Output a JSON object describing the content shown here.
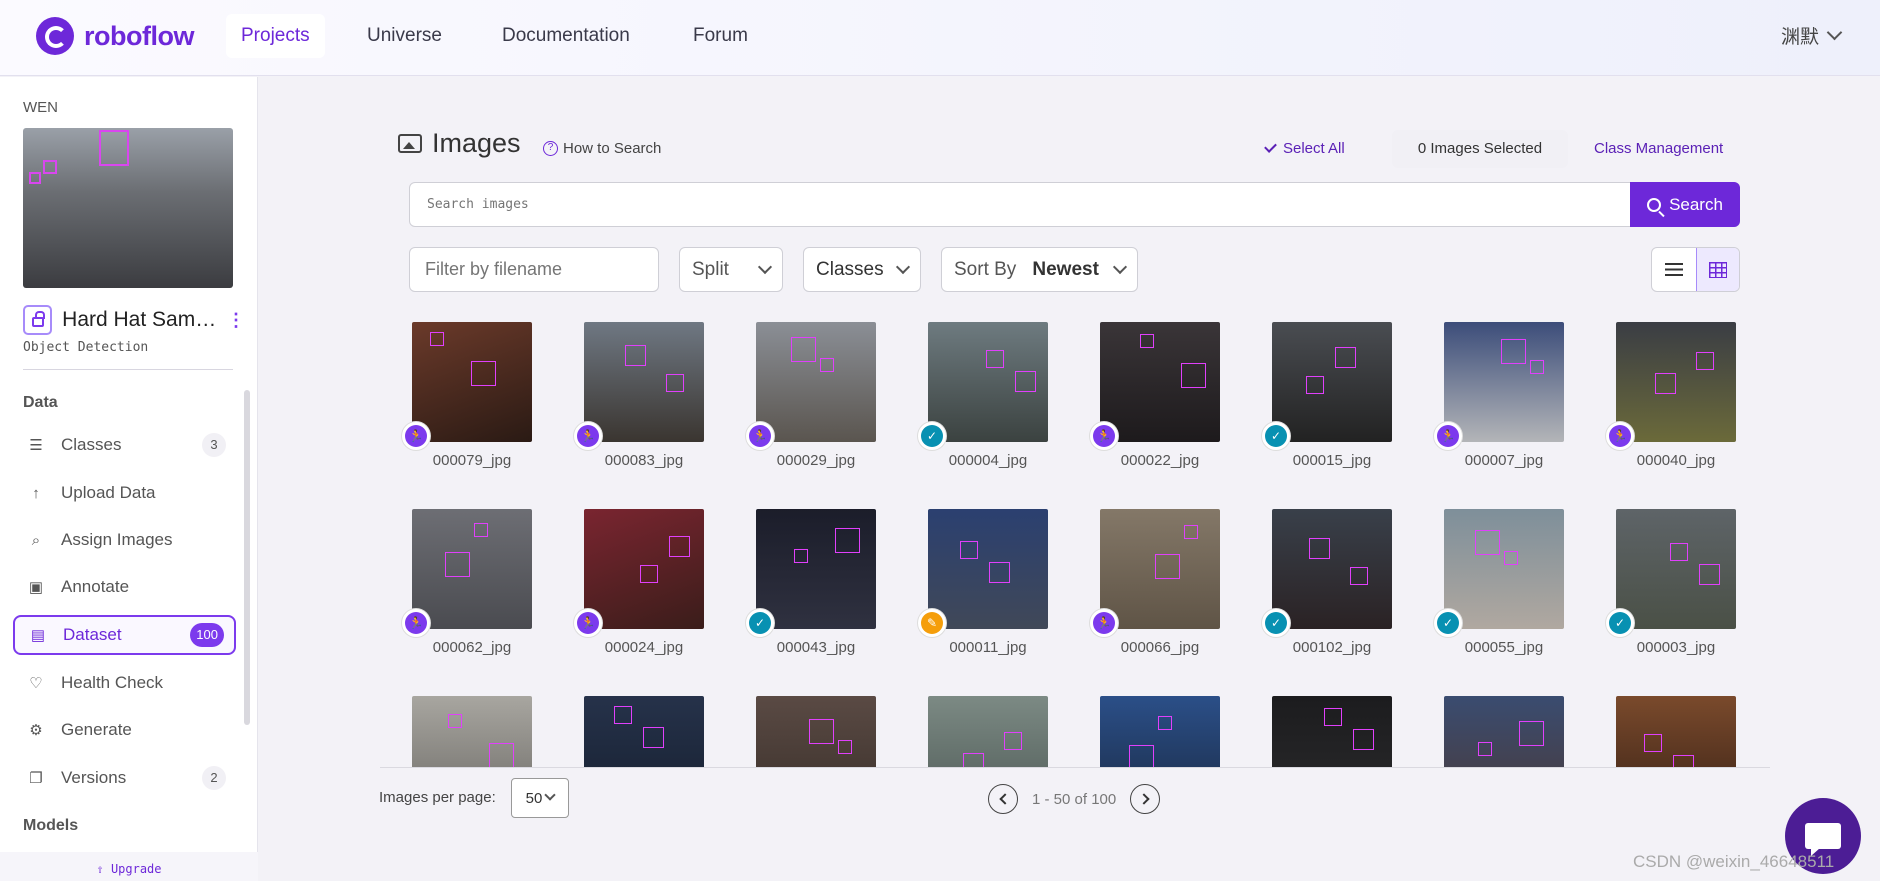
{
  "app": {
    "name": "roboflow",
    "brand_color": "#6d28d9"
  },
  "nav": {
    "tabs": [
      "Projects",
      "Universe",
      "Documentation",
      "Forum"
    ],
    "active": "Projects",
    "user": "渊默"
  },
  "sidebar": {
    "workspace": "WEN",
    "project_name": "Hard Hat Samp...",
    "project_type": "Object Detection",
    "section_data": "Data",
    "items": [
      {
        "label": "Classes",
        "count": "3",
        "icon": "list-icon"
      },
      {
        "label": "Upload Data",
        "count": null,
        "icon": "upload-icon"
      },
      {
        "label": "Assign Images",
        "count": null,
        "icon": "search-icon"
      },
      {
        "label": "Annotate",
        "count": null,
        "icon": "annotate-icon"
      },
      {
        "label": "Dataset",
        "count": "100",
        "icon": "dataset-icon"
      },
      {
        "label": "Health Check",
        "count": null,
        "icon": "heart-icon"
      },
      {
        "label": "Generate",
        "count": null,
        "icon": "generate-icon"
      },
      {
        "label": "Versions",
        "count": "2",
        "icon": "versions-icon"
      }
    ],
    "active_item": "Dataset",
    "section_models": "Models",
    "upgrade": "Upgrade"
  },
  "main": {
    "title": "Images",
    "how_to_search": "How to Search",
    "select_all": "Select All",
    "selected": "0 Images Selected",
    "class_management": "Class Management",
    "search_placeholder": "Search images",
    "search_button": "Search",
    "filter_placeholder": "Filter by filename",
    "split_label": "Split",
    "classes_label": "Classes",
    "sort_label": "Sort By",
    "sort_value": "Newest"
  },
  "images": [
    {
      "name": "000079_jpg",
      "status": "purple"
    },
    {
      "name": "000083_jpg",
      "status": "purple"
    },
    {
      "name": "000029_jpg",
      "status": "purple"
    },
    {
      "name": "000004_jpg",
      "status": "blue"
    },
    {
      "name": "000022_jpg",
      "status": "purple"
    },
    {
      "name": "000015_jpg",
      "status": "blue"
    },
    {
      "name": "000007_jpg",
      "status": "purple"
    },
    {
      "name": "000040_jpg",
      "status": "purple"
    },
    {
      "name": "000062_jpg",
      "status": "purple"
    },
    {
      "name": "000024_jpg",
      "status": "purple"
    },
    {
      "name": "000043_jpg",
      "status": "blue"
    },
    {
      "name": "000011_jpg",
      "status": "orange"
    },
    {
      "name": "000066_jpg",
      "status": "purple"
    },
    {
      "name": "000102_jpg",
      "status": "blue"
    },
    {
      "name": "000055_jpg",
      "status": "blue"
    },
    {
      "name": "000003_jpg",
      "status": "blue"
    },
    {
      "name": "",
      "status": ""
    },
    {
      "name": "",
      "status": ""
    },
    {
      "name": "",
      "status": ""
    },
    {
      "name": "",
      "status": ""
    },
    {
      "name": "",
      "status": ""
    },
    {
      "name": "",
      "status": ""
    },
    {
      "name": "",
      "status": ""
    },
    {
      "name": "",
      "status": ""
    }
  ],
  "pagination": {
    "per_page_label": "Images per page:",
    "per_page": "50",
    "range": "1 - 50 of 100"
  },
  "watermark": "CSDN @weixin_46648511"
}
